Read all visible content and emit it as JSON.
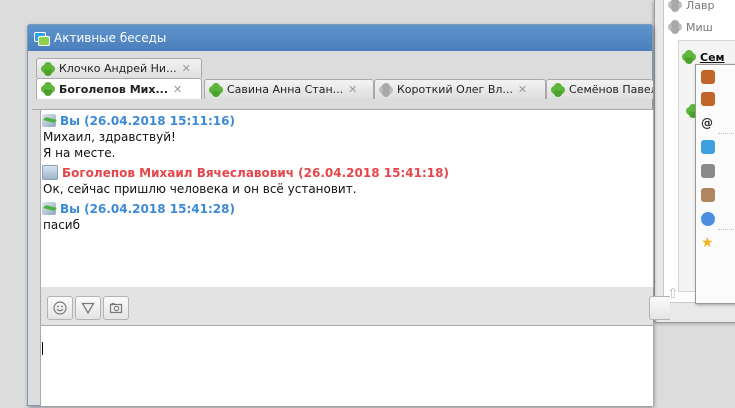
{
  "background_window": {
    "rows": [
      {
        "label": "Лавр"
      },
      {
        "label": "Миш"
      },
      {
        "label": "Сем"
      }
    ]
  },
  "window": {
    "title": "Активные беседы"
  },
  "tabs_row1": [
    {
      "label": "Клочко Андрей Ни...",
      "close": "✕"
    }
  ],
  "tabs_row2": [
    {
      "label": "Боголепов Мих...",
      "close": "✕",
      "active": true
    },
    {
      "label": "Савина Анна Стан...",
      "close": "✕"
    },
    {
      "label": "Короткий Олег Вл...",
      "close": "✕"
    },
    {
      "label": "Семёнов Павел"
    }
  ],
  "messages": [
    {
      "sender": "Вы",
      "timestamp": "(26.04.2018 15:11:16)",
      "header": "Вы (26.04.2018 15:11:16)",
      "own": true,
      "lines": [
        "Михаил, здравствуй!",
        "Я на месте."
      ]
    },
    {
      "sender": "Боголепов Михаил Вячеславович",
      "timestamp": "(26.04.2018 15:41:18)",
      "header": "Боголепов Михаил Вячеславович (26.04.2018 15:41:18)",
      "own": false,
      "lines": [
        "Ок, сейчас пришлю человека и он всё установит."
      ]
    },
    {
      "sender": "Вы",
      "timestamp": "(26.04.2018 15:41:28)",
      "header": "Вы (26.04.2018 15:41:28)",
      "own": true,
      "lines": [
        "пасиб"
      ]
    }
  ],
  "toolbar": {
    "buttons": [
      {
        "icon": "smiley-icon"
      },
      {
        "icon": "filter-icon"
      },
      {
        "icon": "camera-icon"
      }
    ]
  },
  "input": {
    "value": ""
  },
  "colors": {
    "own_sender": "#3d8ad6",
    "other_sender": "#e5474b",
    "titlebar": "#4f85c2"
  }
}
